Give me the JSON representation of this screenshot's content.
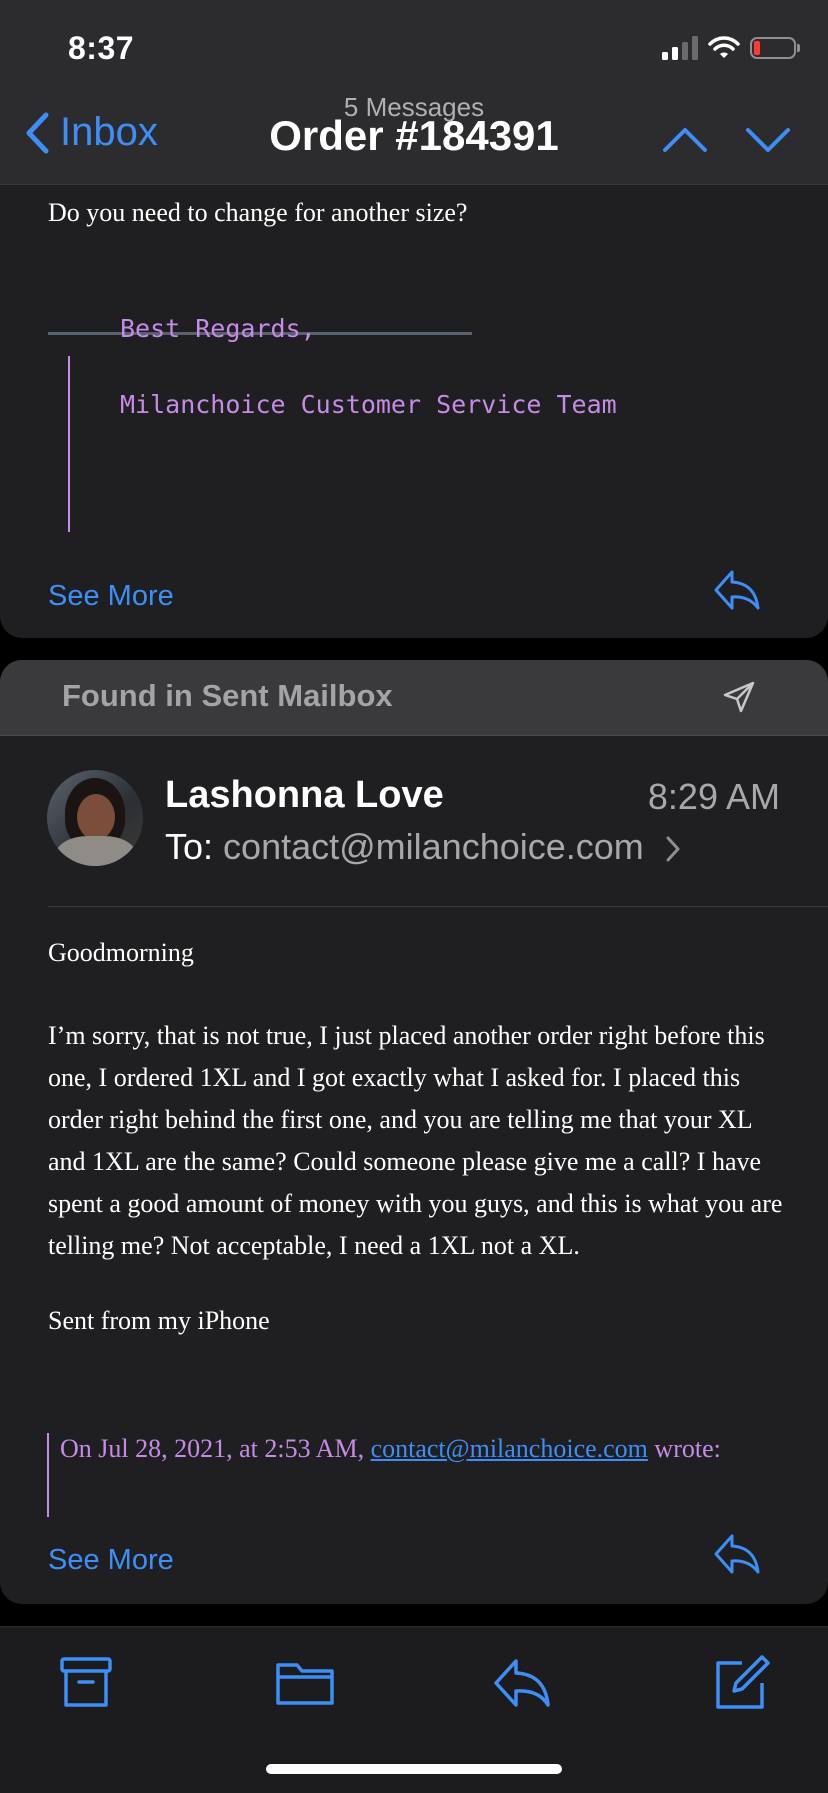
{
  "status_bar": {
    "time": "8:37",
    "icons": [
      "cellular-signal-icon",
      "wifi-icon",
      "battery-low-icon"
    ]
  },
  "nav": {
    "back_label": "Inbox",
    "message_count": "5 Messages",
    "title": "Order #184391",
    "icons": [
      "chevron-left-icon",
      "chevron-up-icon",
      "chevron-down-icon"
    ]
  },
  "message_1": {
    "body_tail": "Do you need to change for another size?",
    "signature": [
      "Best Regards,",
      "Milanchoice Customer Service Team"
    ],
    "see_more": "See More"
  },
  "message_2": {
    "banner": "Found in Sent Mailbox",
    "sender": "Lashonna Love",
    "time": "8:29 AM",
    "to_label": "To:",
    "to_address": "contact@milanchoice.com",
    "greeting": "Goodmorning",
    "body": "I’m sorry, that is not true, I just placed another order right before this one, I ordered 1XL and I got exactly what I asked for. I placed this order right behind the first one, and you are telling me that your XL and 1XL are the same? Could someone please give me a call? I have spent a good amount of money with you guys, and this is what you are telling me? Not acceptable, I need a 1XL not a XL.",
    "signoff": "Sent from my iPhone",
    "quote_prefix": "On Jul 28, 2021, at 2:53 AM,",
    "quote_email": "contact@milanchoice.com",
    "quote_suffix": "wrote:",
    "see_more": "See More"
  },
  "toolbar": {
    "icons": [
      "archive-icon",
      "folder-icon",
      "reply-icon",
      "compose-icon"
    ]
  },
  "colors": {
    "accent": "#3d8ff7",
    "quote": "#c58be6",
    "background": "#000000",
    "card": "#1f1f21",
    "header": "#2c2c2e"
  }
}
